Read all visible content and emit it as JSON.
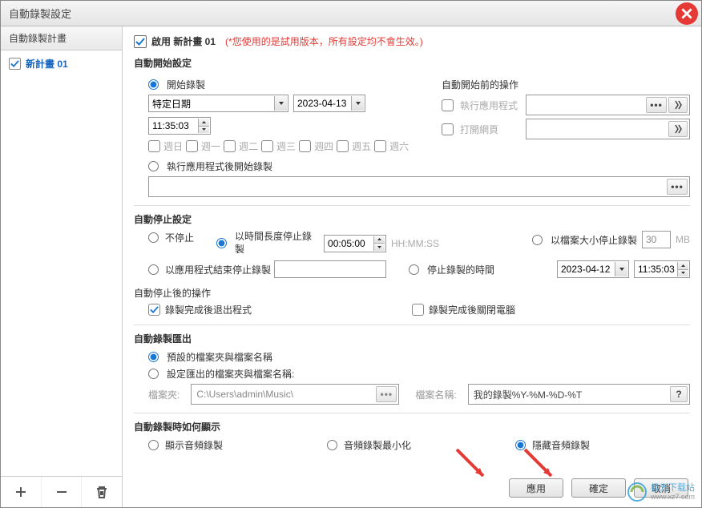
{
  "window": {
    "title": "自動錄製設定"
  },
  "sidebar": {
    "header": "自動錄製計畫",
    "plan_name": "新計畫 01"
  },
  "header": {
    "enable_label": "啟用 新計畫 01",
    "trial_note": "(*您使用的是試用版本，所有設定均不會生效。)"
  },
  "auto_start": {
    "section": "自動開始設定",
    "opt_start_recording": "開始錄製",
    "date_mode": "特定日期",
    "date_value": "2023-04-13",
    "time_value": "11:35:03",
    "days": [
      "週日",
      "週一",
      "週二",
      "週三",
      "週四",
      "週五",
      "週六"
    ],
    "opt_after_app": "執行應用程式後開始錄製",
    "pre_section": "自動開始前的操作",
    "chk_run_app": "執行應用程式",
    "chk_open_web": "打開網頁"
  },
  "auto_stop": {
    "section": "自動停止設定",
    "opt_no_stop": "不停止",
    "opt_by_duration": "以時間長度停止錄製",
    "duration_value": "00:05:00",
    "duration_hint": "HH:MM:SS",
    "opt_by_size": "以檔案大小停止錄製",
    "size_value": "30",
    "size_unit": "MB",
    "opt_by_app_end": "以應用程式結束停止錄製",
    "opt_by_time": "停止錄製的時間",
    "stop_date": "2023-04-12",
    "stop_time": "11:35:03",
    "after_section": "自動停止後的操作",
    "chk_exit_after": "錄製完成後退出程式",
    "chk_shutdown_after": "錄製完成後關閉電腦"
  },
  "export": {
    "section": "自動錄製匯出",
    "opt_default": "預設的檔案夾與檔案名稱",
    "opt_custom": "設定匯出的檔案夾與檔案名稱:",
    "folder_label": "檔案夾:",
    "folder_value": "C:\\Users\\admin\\Music\\",
    "name_label": "檔案名稱:",
    "name_value": "我的錄製%Y-%M-%D-%T"
  },
  "display": {
    "section": "自動錄製時如何顯示",
    "opt_show": "顯示音頻錄製",
    "opt_min": "音頻錄製最小化",
    "opt_hide": "隱藏音頻錄製"
  },
  "buttons": {
    "apply": "應用",
    "ok": "確定",
    "cancel": "取消"
  },
  "watermark": {
    "name": "极光下载站",
    "url": "www.xz7.com"
  }
}
